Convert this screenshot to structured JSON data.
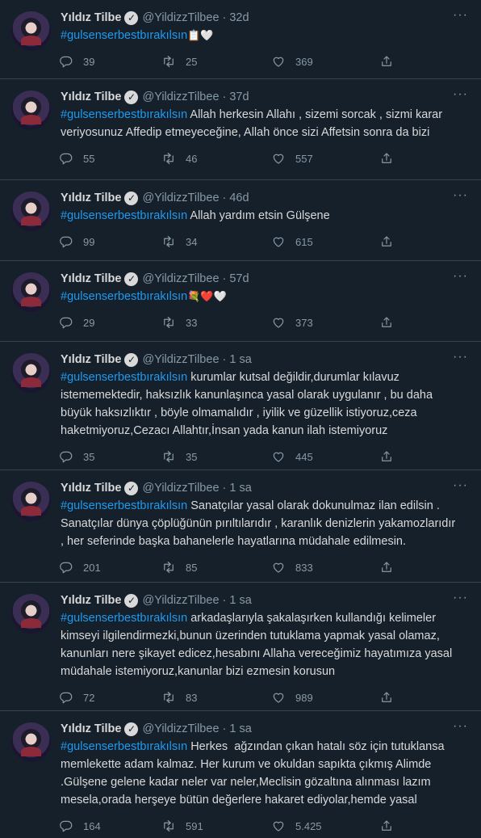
{
  "author": {
    "name": "Yıldız Tilbe",
    "handle": "@YildizzTilbee"
  },
  "tweets": [
    {
      "time": "32d",
      "hashtag": "#gulsenserbestbırakılsın",
      "text": "",
      "emoji": "📋🤍",
      "lines": [],
      "replies": "39",
      "retweets": "25",
      "likes": "369"
    },
    {
      "time": "37d",
      "hashtag": "#gulsenserbestbırakılsın",
      "text": "Allah herkesin Allahı , sizemi sorcak , sizmi karar",
      "emoji": "",
      "lines": [
        "veriyosunuz Affedip etmeyeceğine, Allah önce sizi Affetsin sonra da bizi"
      ],
      "replies": "55",
      "retweets": "46",
      "likes": "557"
    },
    {
      "time": "46d",
      "hashtag": "#gulsenserbestbırakılsın",
      "text": "Allah yardım etsin Gülşene",
      "emoji": "",
      "lines": [],
      "replies": "99",
      "retweets": "34",
      "likes": "615"
    },
    {
      "time": "57d",
      "hashtag": "#gulsenserbestbırakılsın",
      "text": "",
      "emoji": "💐❤️🤍",
      "lines": [],
      "replies": "29",
      "retweets": "33",
      "likes": "373"
    },
    {
      "time": "1 sa",
      "hashtag": "#gulsenserbestbırakılsın",
      "text": "kurumlar kutsal değildir,durumlar kılavuz",
      "emoji": "",
      "lines": [
        "istememektedir, haksızlık kanunlaşınca yasal olarak uygulanır , bu daha",
        "büyük haksızlıktır , böyle olmamalıdır , iyilik ve güzellik istiyoruz,ceza",
        "haketmiyoruz,Cezacı Allahtır,İnsan yada kanun ilah istemiyoruz"
      ],
      "replies": "35",
      "retweets": "35",
      "likes": "445"
    },
    {
      "time": "1 sa",
      "hashtag": "#gulsenserbestbırakılsın",
      "text": "Sanatçılar yasal olarak dokunulmaz ilan edilsin .",
      "emoji": "",
      "lines": [
        "Sanatçılar dünya çöplüğünün pırıltılarıdır , karanlık denizlerin yakamozlarıdır",
        ", her seferinde başka bahanelerle hayatlarına müdahale edilmesin."
      ],
      "replies": "201",
      "retweets": "85",
      "likes": "833"
    },
    {
      "time": "1 sa",
      "hashtag": "#gulsenserbestbırakılsın",
      "text": "arkadaşlarıyla şakalaşırken kullandığı kelimeler",
      "emoji": "",
      "lines": [
        "kimseyi ilgilendirmezki,bunun üzerinden tutuklama yapmak yasal olamaz,",
        "kanunları nere şikayet edicez,hesabını Allaha vereceğimiz hayatımıza yasal",
        "müdahale istemiyoruz,kanunlar bizi ezmesin korusun"
      ],
      "replies": "72",
      "retweets": "83",
      "likes": "989"
    },
    {
      "time": "1 sa",
      "hashtag": "#gulsenserbestbırakılsın",
      "text": "Herkes  ağzından çıkan hatalı söz için tutuklansa",
      "emoji": "",
      "lines": [
        "memlekette adam kalmaz. Her kurum ve okuldan sapıkta çıkmış Alimde",
        ".Gülşene gelene kadar neler var neler,Meclisin gözaltına alınması lazım",
        "mesela,orada herşeye bütün değerlere hakaret ediyolar,hemde yasal"
      ],
      "replies": "164",
      "retweets": "591",
      "likes": "5.425"
    }
  ]
}
